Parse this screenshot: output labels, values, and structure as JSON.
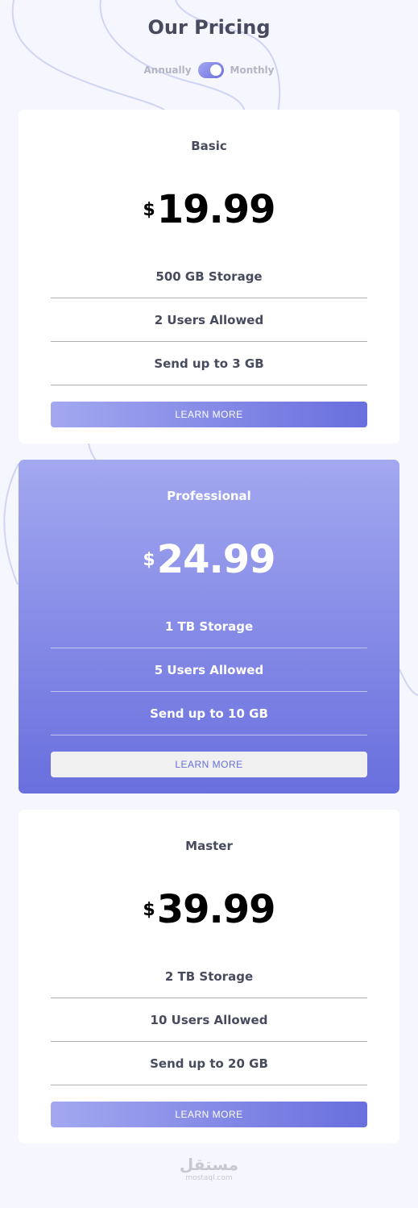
{
  "header": {
    "title": "Our Pricing",
    "toggle_left": "Annually",
    "toggle_right": "Monthly",
    "toggle_state": "Monthly"
  },
  "plans": [
    {
      "name": "Basic",
      "currency": "$",
      "price": "19.99",
      "features": [
        "500 GB Storage",
        "2 Users Allowed",
        "Send up to 3 GB"
      ],
      "button": "LEARN MORE"
    },
    {
      "name": "Professional",
      "currency": "$",
      "price": "24.99",
      "features": [
        "1 TB Storage",
        "5 Users Allowed",
        "Send up to 10 GB"
      ],
      "button": "LEARN MORE"
    },
    {
      "name": "Master",
      "currency": "$",
      "price": "39.99",
      "features": [
        "2 TB Storage",
        "10 Users Allowed",
        "Send up to 20 GB"
      ],
      "button": "LEARN MORE"
    }
  ],
  "footer": {
    "logo_arabic": "مستقل",
    "logo_latin": "mostaql.com"
  },
  "colors": {
    "background": "#f5f6fe",
    "accent_light": "#a3a8f0",
    "accent_dark": "#696fdd",
    "text": "#484b5e"
  }
}
